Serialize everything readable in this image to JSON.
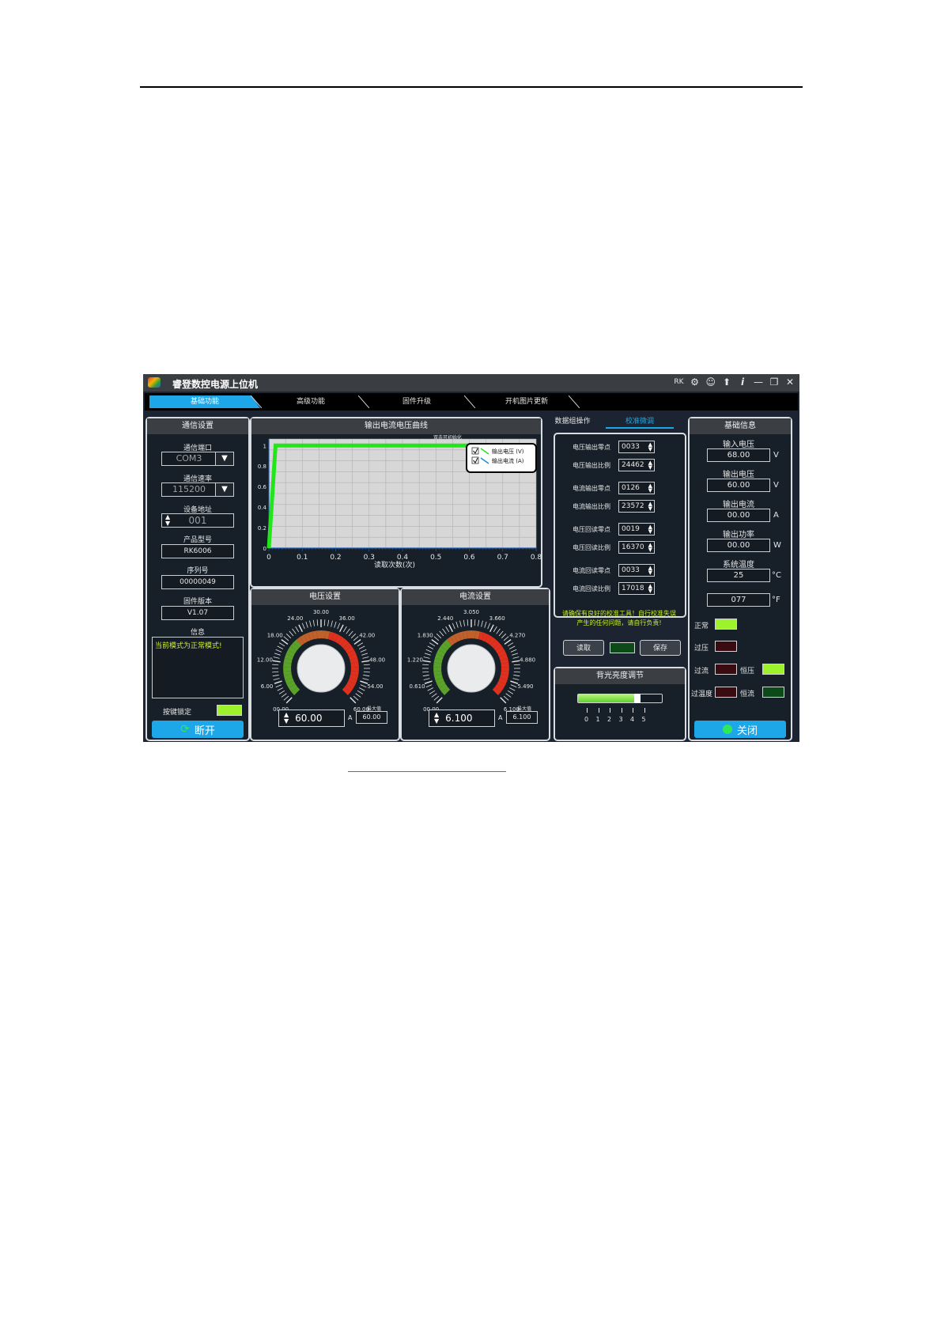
{
  "window": {
    "title": "睿登数控电源上位机",
    "brand": "RK"
  },
  "tabs": [
    "基础功能",
    "高级功能",
    "固件升级",
    "开机图片更新"
  ],
  "comm": {
    "title": "通信设置",
    "port_label": "通信端口",
    "port_value": "COM3",
    "baud_label": "通信速率",
    "baud_value": "115200",
    "addr_label": "设备地址",
    "addr_value": "001",
    "model_label": "产品型号",
    "model_value": "RK6006",
    "serial_label": "序列号",
    "serial_value": "00000049",
    "fw_label": "固件版本",
    "fw_value": "V1.07",
    "info_label": "信息",
    "info_text": "当前模式为正常模式!",
    "keylock_label": "按键锁定",
    "disconnect_label": "断开"
  },
  "chart": {
    "title": "输出电流电压曲线",
    "hint": "双击可初始化",
    "xlabel": "读取次数(次)",
    "legend": [
      "输出电压 (V)",
      "输出电流 (A)"
    ],
    "x_ticks": [
      "0",
      "0.1",
      "0.2",
      "0.3",
      "0.4",
      "0.5",
      "0.6",
      "0.7",
      "0.8"
    ],
    "y_ticks": [
      "0",
      "0.2",
      "0.4",
      "0.6",
      "0.8",
      "1"
    ]
  },
  "chart_data": {
    "type": "line",
    "xlabel": "读取次数(次)",
    "ylabel": "",
    "xlim": [
      0,
      0.8
    ],
    "ylim": [
      0,
      1
    ],
    "series": [
      {
        "name": "输出电压 (V)",
        "color": "#22e51b",
        "x": [
          0,
          0.02,
          0.6
        ],
        "y": [
          0,
          1,
          1
        ]
      },
      {
        "name": "输出电流 (A)",
        "color": "#1a8fd6",
        "x": [
          0,
          0.02,
          0.6
        ],
        "y": [
          0,
          1,
          1
        ]
      }
    ]
  },
  "voltage": {
    "title": "电压设置",
    "ticks": [
      "00.00",
      "6.00",
      "12.00",
      "18.00",
      "24.00",
      "30.00",
      "36.00",
      "42.00",
      "48.00",
      "54.00",
      "60.00"
    ],
    "value": "60.00",
    "unit": "A",
    "max_label": "最大值",
    "max_value": "60.00",
    "setpoint_fraction": 1.0
  },
  "current": {
    "title": "电流设置",
    "ticks": [
      "00.00",
      "0.610",
      "1.220",
      "1.830",
      "2.440",
      "3.050",
      "3.660",
      "4.270",
      "4.880",
      "5.490",
      "6.100"
    ],
    "value": "6.100",
    "unit": "A",
    "max_label": "最大值",
    "max_value": "6.100",
    "setpoint_fraction": 1.0
  },
  "calib": {
    "tab_data": "数据组操作",
    "tab_calib": "校准微调",
    "rows": [
      {
        "label": "电压输出零点",
        "value": "0033"
      },
      {
        "label": "电压输出比例",
        "value": "24462"
      },
      {
        "label": "电流输出零点",
        "value": "0126"
      },
      {
        "label": "电流输出比例",
        "value": "23572"
      },
      {
        "label": "电压回读零点",
        "value": "0019"
      },
      {
        "label": "电压回读比例",
        "value": "16370"
      },
      {
        "label": "电流回读零点",
        "value": "0033"
      },
      {
        "label": "电流回读比例",
        "value": "17018"
      }
    ],
    "warning": "请确保有良好的校准工具！自行校准失误产生的任何问题，请自行负责!",
    "read_label": "读取",
    "save_label": "保存"
  },
  "backlight": {
    "title": "背光亮度调节",
    "ticks": [
      "0",
      "1",
      "2",
      "3",
      "4",
      "5"
    ],
    "level": 4
  },
  "info": {
    "title": "基础信息",
    "in_v_label": "输入电压",
    "in_v": "68.00",
    "in_v_unit": "V",
    "out_v_label": "输出电压",
    "out_v": "60.00",
    "out_v_unit": "V",
    "out_a_label": "输出电流",
    "out_a": "00.00",
    "out_a_unit": "A",
    "out_w_label": "输出功率",
    "out_w": "00.00",
    "out_w_unit": "W",
    "temp_label": "系统温度",
    "temp_c": "25",
    "temp_c_unit": "°C",
    "temp_f": "077",
    "temp_f_unit": "°F",
    "status": {
      "normal": "正常",
      "ovp": "过压",
      "ocp": "过流",
      "otp": "过温度",
      "cv": "恒压",
      "cc": "恒流"
    },
    "close_label": "关闭"
  },
  "colors": {
    "accent": "#1da7e8",
    "led_on": "#9df22c",
    "led_off_red": "#3a0c12",
    "led_off_green": "#0c4a18"
  }
}
